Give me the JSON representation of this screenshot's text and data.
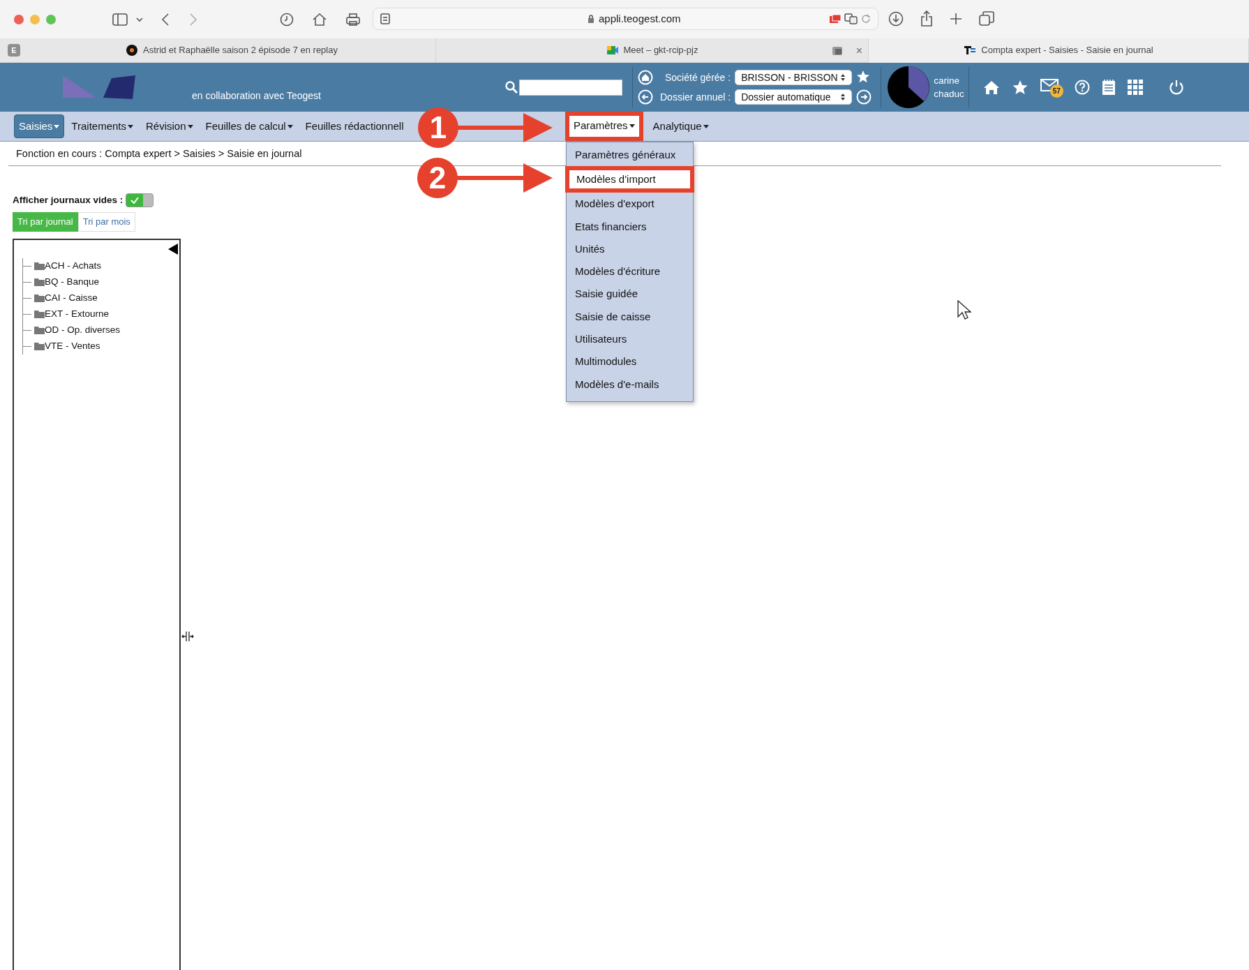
{
  "browser": {
    "url": "appli.teogest.com",
    "group_badge": "E",
    "tabs": [
      {
        "title": "Astrid et Raphaëlle saison 2 épisode 7 en replay",
        "selected": false
      },
      {
        "title": "Meet – gkt-rcip-pjz",
        "selected": false,
        "close": "×"
      },
      {
        "title": "Compta expert - Saisies - Saisie en journal",
        "selected": true
      }
    ]
  },
  "header": {
    "tagline": "en collaboration avec Teogest",
    "company_label": "Société gérée :",
    "company_value": "BRISSON - BRISSON",
    "folder_label": "Dossier annuel :",
    "folder_value": "Dossier automatique",
    "user_first": "carine",
    "user_last": "chaduc",
    "mail_badge": "57"
  },
  "menu": [
    {
      "label": "Saisies",
      "selected": true,
      "open": false,
      "caret": true
    },
    {
      "label": "Traitements",
      "selected": false,
      "open": false,
      "caret": true
    },
    {
      "label": "Révision",
      "selected": false,
      "open": false,
      "caret": true
    },
    {
      "label": "Feuilles de calcul",
      "selected": false,
      "open": false,
      "caret": true
    },
    {
      "label": "Feuilles rédactionnell",
      "selected": false,
      "open": false,
      "caret": false
    },
    {
      "label": "Paramètres",
      "selected": false,
      "open": true,
      "caret": true
    },
    {
      "label": "Analytique",
      "selected": false,
      "open": false,
      "caret": true
    }
  ],
  "dropdown": [
    {
      "label": "Paramètres généraux",
      "selected": false
    },
    {
      "label": "Modèles d'import",
      "selected": true
    },
    {
      "label": "Modèles d'export",
      "selected": false
    },
    {
      "label": "Etats financiers",
      "selected": false
    },
    {
      "label": "Unités",
      "selected": false
    },
    {
      "label": "Modèles d'écriture",
      "selected": false
    },
    {
      "label": "Saisie guidée",
      "selected": false
    },
    {
      "label": "Saisie de caisse",
      "selected": false
    },
    {
      "label": "Utilisateurs",
      "selected": false
    },
    {
      "label": "Multimodules",
      "selected": false
    },
    {
      "label": "Modèles d'e-mails",
      "selected": false
    }
  ],
  "breadcrumb": "Fonction en cours :  Compta expert > Saisies > Saisie en journal",
  "empty_journals": {
    "label": "Afficher journaux vides :",
    "on": true
  },
  "sort_tabs": [
    {
      "label": "Tri par journal",
      "selected": true
    },
    {
      "label": "Tri par mois",
      "selected": false
    }
  ],
  "tree": [
    {
      "label": "ACH - Achats"
    },
    {
      "label": "BQ - Banque"
    },
    {
      "label": "CAI - Caisse"
    },
    {
      "label": "EXT - Extourne"
    },
    {
      "label": "OD - Op. diverses"
    },
    {
      "label": "VTE - Ventes"
    }
  ],
  "annotations": [
    {
      "number": "1"
    },
    {
      "number": "2"
    }
  ]
}
